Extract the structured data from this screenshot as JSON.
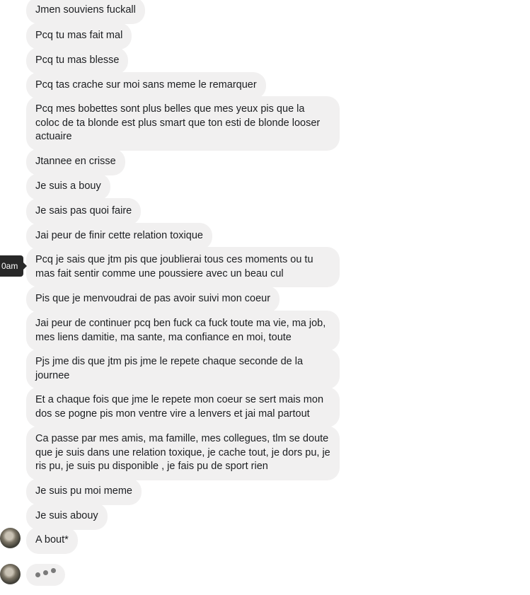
{
  "tooltip": {
    "time": "0am"
  },
  "messages": [
    "Jmen souviens fuckall",
    "Pcq tu mas fait mal",
    "Pcq tu mas blesse",
    "Pcq tas crache sur moi sans meme le remarquer",
    "Pcq mes bobettes sont plus belles que mes yeux pis que la coloc de ta blonde est plus smart que ton esti de blonde looser actuaire",
    "Jtannee en crisse",
    "Je suis a bouy",
    "Je sais pas quoi faire",
    "Jai peur de finir cette relation toxique",
    "Pcq je sais que jtm pis que joublierai tous ces moments ou tu mas fait sentir comme une poussiere avec un beau cul",
    "Pis que je menvoudrai de pas avoir suivi mon coeur",
    "Jai peur de continuer pcq ben fuck ca fuck toute ma vie, ma job, mes liens damitie, ma sante, ma confiance en moi, toute",
    "Pjs jme dis que jtm pis jme le repete chaque seconde de la journee",
    "Et a chaque fois que jme le repete mon coeur se sert mais mon dos se pogne pis mon ventre vire a lenvers et jai mal partout",
    "Ca passe par mes amis, ma famille, mes collegues, tlm se doute que je suis dans une relation toxique, je cache tout, je dors pu, je ris pu, je suis pu disponible , je fais pu de sport rien",
    "Je suis pu moi meme",
    "Je suis abouy",
    "A bout*"
  ]
}
